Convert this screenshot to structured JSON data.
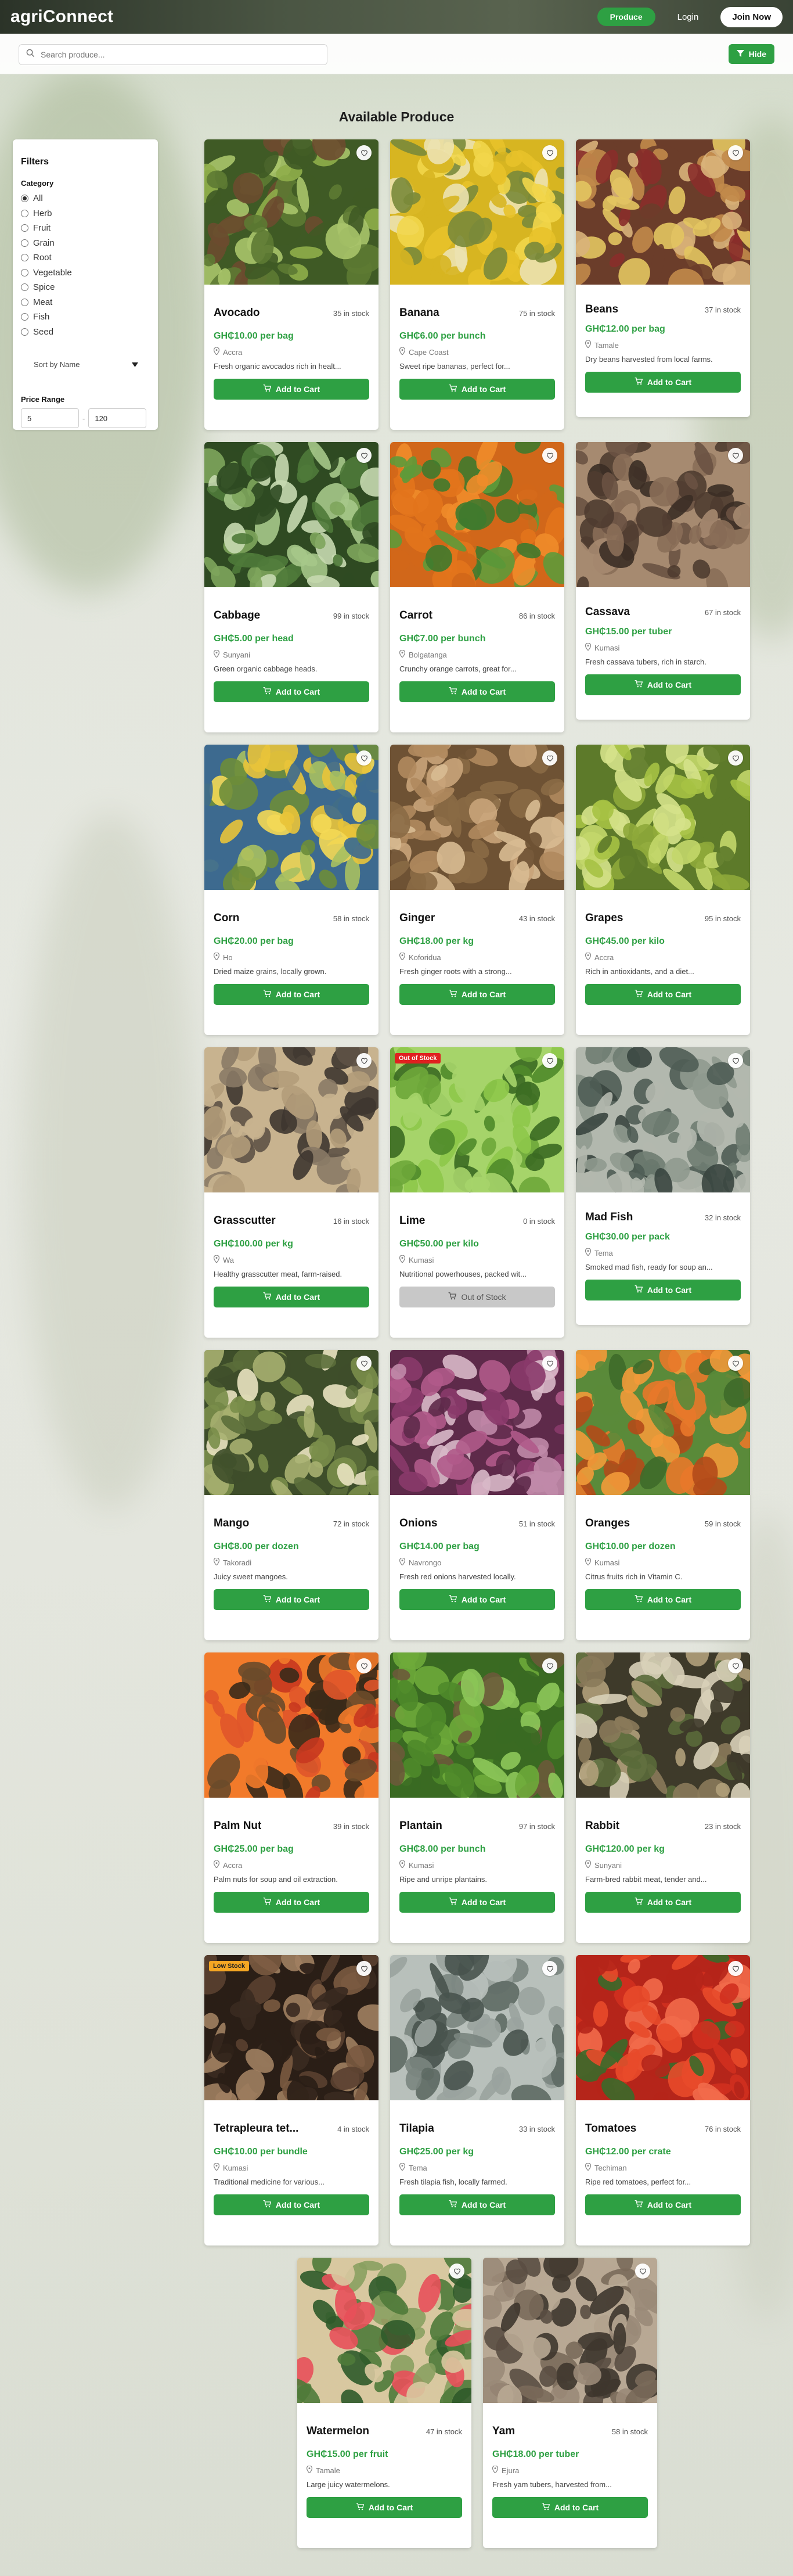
{
  "header": {
    "brand": "agriConnect",
    "nav": {
      "produce": "Produce",
      "login": "Login",
      "join": "Join Now"
    }
  },
  "toolbar": {
    "search_placeholder": "Search produce...",
    "hide_label": "Hide"
  },
  "page_title": "Available Produce",
  "filters": {
    "title": "Filters",
    "category_label": "Category",
    "categories": [
      "All",
      "Herb",
      "Fruit",
      "Grain",
      "Root",
      "Vegetable",
      "Spice",
      "Meat",
      "Fish",
      "Seed"
    ],
    "selected_category": "All",
    "sort_value": "Sort by Name",
    "price_label": "Price Range",
    "price_min": "5",
    "price_max": "120"
  },
  "colors": {
    "accent": "#2ea043",
    "low_stock": "#f5a623",
    "out_of_stock": "#e02020"
  },
  "products": [
    {
      "name": "Avocado",
      "stock": "35 in stock",
      "price": "GH₵10.00 per bag",
      "location": "Accra",
      "description": "Fresh organic avocados rich in healt...",
      "button": "Add to Cart",
      "badge": ""
    },
    {
      "name": "Banana",
      "stock": "75 in stock",
      "price": "GH₵6.00 per bunch",
      "location": "Cape Coast",
      "description": "Sweet ripe bananas, perfect for...",
      "button": "Add to Cart",
      "badge": ""
    },
    {
      "name": "Beans",
      "stock": "37 in stock",
      "price": "GH₵12.00 per bag",
      "location": "Tamale",
      "description": "Dry beans harvested from local farms.",
      "button": "Add to Cart",
      "badge": ""
    },
    {
      "name": "Cabbage",
      "stock": "99 in stock",
      "price": "GH₵5.00 per head",
      "location": "Sunyani",
      "description": "Green organic cabbage heads.",
      "button": "Add to Cart",
      "badge": ""
    },
    {
      "name": "Carrot",
      "stock": "86 in stock",
      "price": "GH₵7.00 per bunch",
      "location": "Bolgatanga",
      "description": "Crunchy orange carrots, great for...",
      "button": "Add to Cart",
      "badge": ""
    },
    {
      "name": "Cassava",
      "stock": "67 in stock",
      "price": "GH₵15.00 per tuber",
      "location": "Kumasi",
      "description": "Fresh cassava tubers, rich in starch.",
      "button": "Add to Cart",
      "badge": ""
    },
    {
      "name": "Corn",
      "stock": "58 in stock",
      "price": "GH₵20.00 per bag",
      "location": "Ho",
      "description": "Dried maize grains, locally grown.",
      "button": "Add to Cart",
      "badge": ""
    },
    {
      "name": "Ginger",
      "stock": "43 in stock",
      "price": "GH₵18.00 per kg",
      "location": "Koforidua",
      "description": "Fresh ginger roots with a strong...",
      "button": "Add to Cart",
      "badge": ""
    },
    {
      "name": "Grapes",
      "stock": "95 in stock",
      "price": "GH₵45.00 per kilo",
      "location": "Accra",
      "description": "Rich in antioxidants, and a diet...",
      "button": "Add to Cart",
      "badge": ""
    },
    {
      "name": "Grasscutter",
      "stock": "16 in stock",
      "price": "GH₵100.00 per kg",
      "location": "Wa",
      "description": "Healthy grasscutter meat, farm-raised.",
      "button": "Add to Cart",
      "badge": ""
    },
    {
      "name": "Lime",
      "stock": "0 in stock",
      "price": "GH₵50.00 per kilo",
      "location": "Kumasi",
      "description": "Nutritional powerhouses, packed wit...",
      "button": "Out of Stock",
      "badge": "Out of Stock"
    },
    {
      "name": "Mad Fish",
      "stock": "32 in stock",
      "price": "GH₵30.00 per pack",
      "location": "Tema",
      "description": "Smoked mad fish, ready for soup an...",
      "button": "Add to Cart",
      "badge": ""
    },
    {
      "name": "Mango",
      "stock": "72 in stock",
      "price": "GH₵8.00 per dozen",
      "location": "Takoradi",
      "description": "Juicy sweet mangoes.",
      "button": "Add to Cart",
      "badge": ""
    },
    {
      "name": "Onions",
      "stock": "51 in stock",
      "price": "GH₵14.00 per bag",
      "location": "Navrongo",
      "description": "Fresh red onions harvested locally.",
      "button": "Add to Cart",
      "badge": ""
    },
    {
      "name": "Oranges",
      "stock": "59 in stock",
      "price": "GH₵10.00 per dozen",
      "location": "Kumasi",
      "description": "Citrus fruits rich in Vitamin C.",
      "button": "Add to Cart",
      "badge": ""
    },
    {
      "name": "Palm Nut",
      "stock": "39 in stock",
      "price": "GH₵25.00 per bag",
      "location": "Accra",
      "description": "Palm nuts for soup and oil extraction.",
      "button": "Add to Cart",
      "badge": ""
    },
    {
      "name": "Plantain",
      "stock": "97 in stock",
      "price": "GH₵8.00 per bunch",
      "location": "Kumasi",
      "description": "Ripe and unripe plantains.",
      "button": "Add to Cart",
      "badge": ""
    },
    {
      "name": "Rabbit",
      "stock": "23 in stock",
      "price": "GH₵120.00 per kg",
      "location": "Sunyani",
      "description": "Farm-bred rabbit meat, tender and...",
      "button": "Add to Cart",
      "badge": ""
    },
    {
      "name": "Tetrapleura tet...",
      "stock": "4 in stock",
      "price": "GH₵10.00 per bundle",
      "location": "Kumasi",
      "description": "Traditional medicine for various...",
      "button": "Add to Cart",
      "badge": "Low Stock"
    },
    {
      "name": "Tilapia",
      "stock": "33 in stock",
      "price": "GH₵25.00 per kg",
      "location": "Tema",
      "description": "Fresh tilapia fish, locally farmed.",
      "button": "Add to Cart",
      "badge": ""
    },
    {
      "name": "Tomatoes",
      "stock": "76 in stock",
      "price": "GH₵12.00 per crate",
      "location": "Techiman",
      "description": "Ripe red tomatoes, perfect for...",
      "button": "Add to Cart",
      "badge": ""
    },
    {
      "name": "Watermelon",
      "stock": "47 in stock",
      "price": "GH₵15.00 per fruit",
      "location": "Tamale",
      "description": "Large juicy watermelons.",
      "button": "Add to Cart",
      "badge": ""
    },
    {
      "name": "Yam",
      "stock": "58 in stock",
      "price": "GH₵18.00 per tuber",
      "location": "Ejura",
      "description": "Fresh yam tubers, harvested from...",
      "button": "Add to Cart",
      "badge": ""
    }
  ]
}
